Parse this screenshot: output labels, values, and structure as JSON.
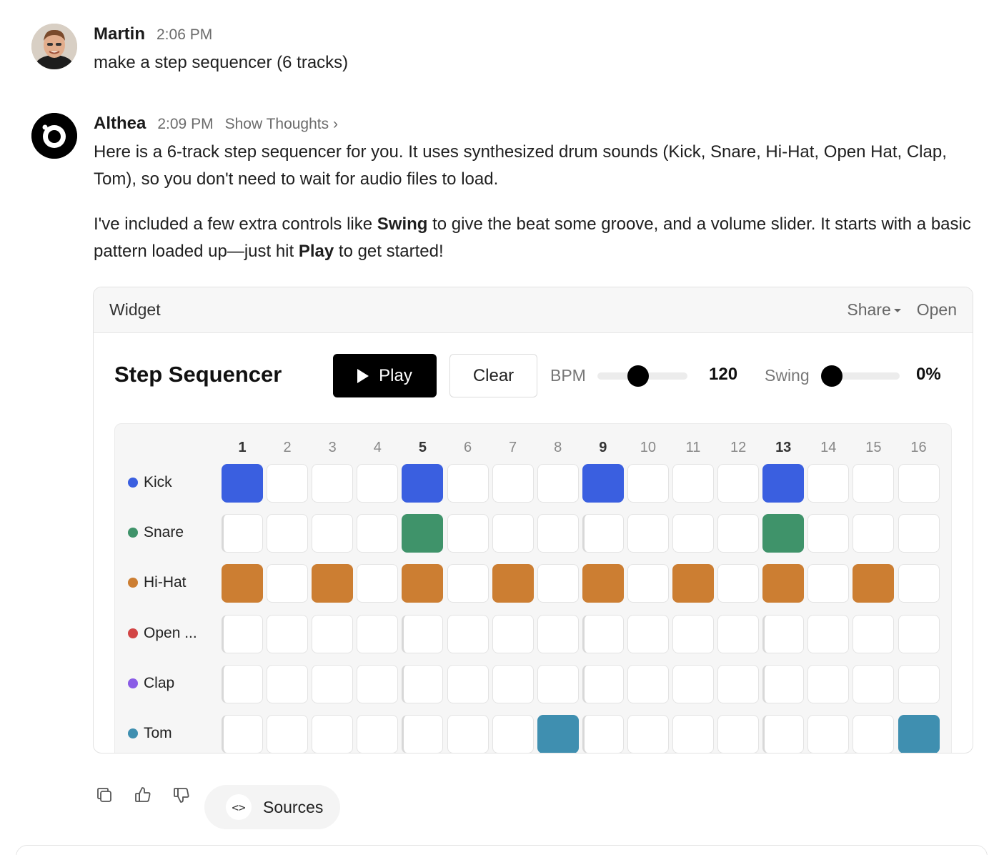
{
  "user_message": {
    "author": "Martin",
    "time": "2:06 PM",
    "text": "make a step sequencer (6 tracks)"
  },
  "bot_message": {
    "author": "Althea",
    "time": "2:09 PM",
    "thoughts_label": "Show Thoughts ›",
    "paragraph1": "Here is a 6-track step sequencer for you. It uses synthesized drum sounds (Kick, Snare, Hi-Hat, Open Hat, Clap, Tom), so you don't need to wait for audio files to load.",
    "p2_a": "I've included a few extra controls like ",
    "p2_swing": "Swing",
    "p2_b": " to give the beat some groove, and a volume slider. It starts with a basic pattern loaded up—just hit ",
    "p2_play": "Play",
    "p2_c": " to get started!"
  },
  "widget": {
    "title": "Widget",
    "share_label": "Share",
    "open_label": "Open"
  },
  "sequencer": {
    "title": "Step Sequencer",
    "play_label": "Play",
    "clear_label": "Clear",
    "bpm_label": "BPM",
    "bpm_value": "120",
    "bpm_fraction": 0.44,
    "swing_label": "Swing",
    "swing_value": "0%",
    "swing_fraction": 0.0,
    "steps": [
      "1",
      "2",
      "3",
      "4",
      "5",
      "6",
      "7",
      "8",
      "9",
      "10",
      "11",
      "12",
      "13",
      "14",
      "15",
      "16"
    ],
    "tracks": [
      {
        "name": "Kick",
        "color": "#3a5fe0",
        "pattern": [
          1,
          0,
          0,
          0,
          1,
          0,
          0,
          0,
          1,
          0,
          0,
          0,
          1,
          0,
          0,
          0
        ]
      },
      {
        "name": "Snare",
        "color": "#3f936a",
        "pattern": [
          0,
          0,
          0,
          0,
          1,
          0,
          0,
          0,
          0,
          0,
          0,
          0,
          1,
          0,
          0,
          0
        ]
      },
      {
        "name": "Hi-Hat",
        "color": "#cc7e32",
        "pattern": [
          1,
          0,
          1,
          0,
          1,
          0,
          1,
          0,
          1,
          0,
          1,
          0,
          1,
          0,
          1,
          0
        ]
      },
      {
        "name": "Open ...",
        "color": "#d24545",
        "pattern": [
          0,
          0,
          0,
          0,
          0,
          0,
          0,
          0,
          0,
          0,
          0,
          0,
          0,
          0,
          0,
          0
        ]
      },
      {
        "name": "Clap",
        "color": "#8a5ce6",
        "pattern": [
          0,
          0,
          0,
          0,
          0,
          0,
          0,
          0,
          0,
          0,
          0,
          0,
          0,
          0,
          0,
          0
        ]
      },
      {
        "name": "Tom",
        "color": "#3f8fb0",
        "pattern": [
          0,
          0,
          0,
          0,
          0,
          0,
          0,
          1,
          0,
          0,
          0,
          0,
          0,
          0,
          0,
          1
        ]
      }
    ]
  },
  "toolbar": {
    "sources_label": "Sources",
    "sources_icon": "<>"
  },
  "icons": {
    "copy": "copy-icon",
    "thumbs_up": "thumbs-up-icon",
    "thumbs_down": "thumbs-down-icon",
    "code": "code-icon"
  }
}
